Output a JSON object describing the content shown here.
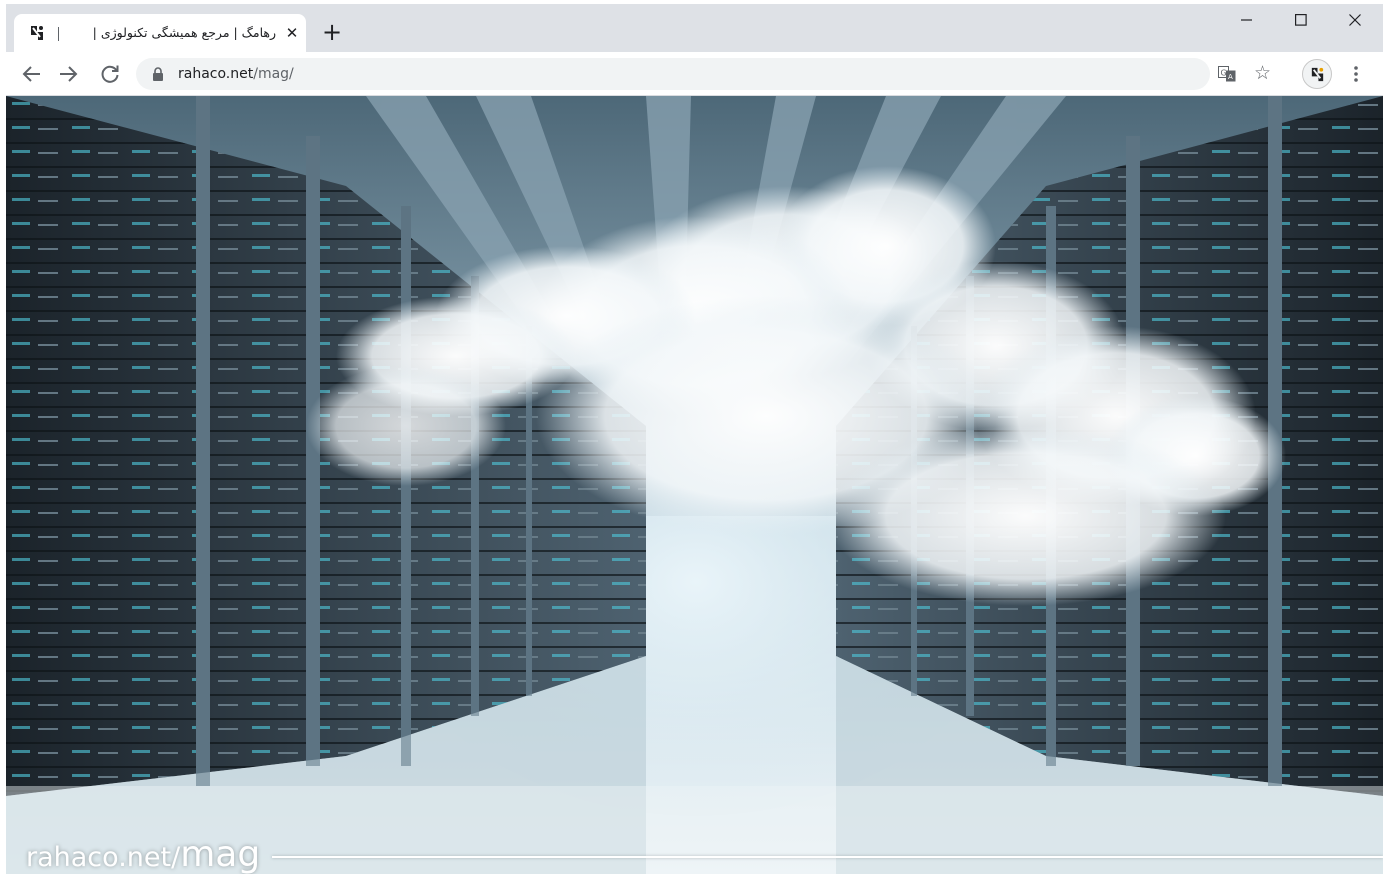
{
  "browser": {
    "tab": {
      "title": "رهامگ | مرجع همیشگی تکنولوژی |",
      "favicon": "rahaco-logo-icon",
      "close_icon": "close-icon"
    },
    "new_tab_icon": "plus-icon",
    "window_controls": [
      "minimize-icon",
      "maximize-icon",
      "close-icon"
    ],
    "nav": {
      "back_icon": "arrow-left-icon",
      "forward_icon": "arrow-right-icon",
      "reload_icon": "reload-icon"
    },
    "address": {
      "host": "rahaco.net",
      "path": "/mag/",
      "lock_icon": "lock-icon"
    },
    "toolbar_icons": [
      "translate-icon",
      "star-icon",
      "profile-avatar",
      "more-vert-icon"
    ]
  },
  "page": {
    "hero_image": "server-room-cloud-photo",
    "watermark": {
      "part1": "rahaco.net/",
      "part2": "mag"
    }
  },
  "colors": {
    "tabstrip_bg": "#dee1e6",
    "toolbar_bg": "#ffffff",
    "omnibox_bg": "#f1f3f4",
    "icon": "#5f6368",
    "text": "#202124"
  }
}
